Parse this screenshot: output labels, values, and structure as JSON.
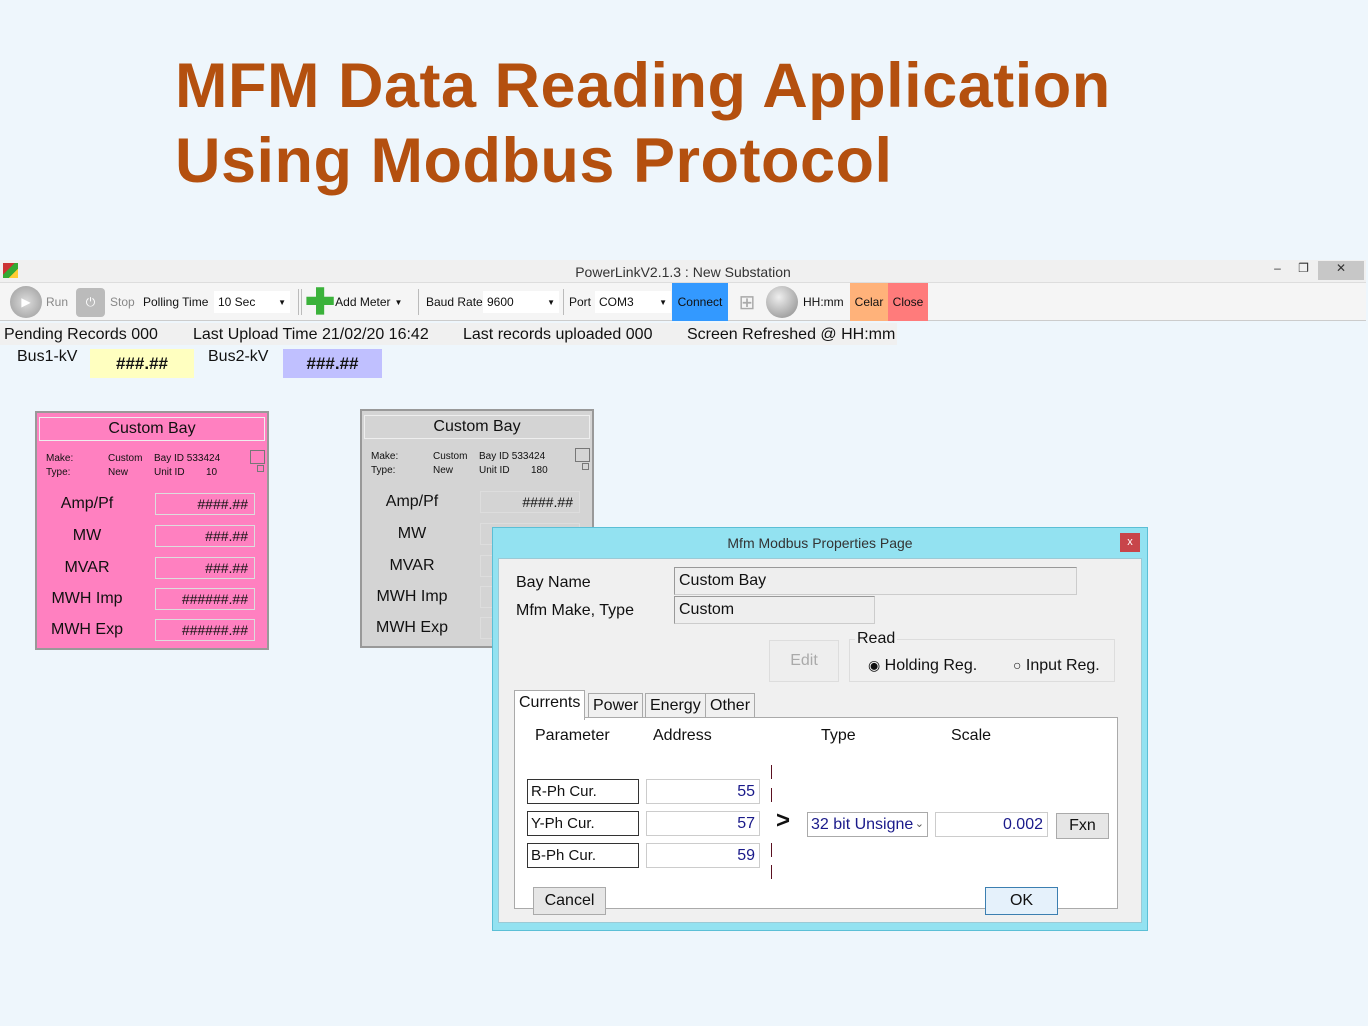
{
  "slide": {
    "title_line1": "MFM Data Reading Application",
    "title_line2": "Using Modbus Protocol"
  },
  "window": {
    "title": "PowerLinkV2.1.3 : New Substation",
    "minimize": "–",
    "restore": "❐",
    "close": "✕"
  },
  "toolbar": {
    "run": "Run",
    "stop": "Stop",
    "polling_label": "Polling Time",
    "polling_value": "10 Sec",
    "add_meter": "Add Meter",
    "baud_label": "Baud Rate",
    "baud_value": "9600",
    "port_label": "Port",
    "port_value": "COM3",
    "connect": "Connect",
    "time": "HH:mm",
    "clear": "Celar",
    "close": "Close",
    "colors": {
      "connect": "#3399ff",
      "clear": "#ffb27a",
      "close": "#ff7b7b"
    }
  },
  "status": {
    "pending": "Pending Records  000",
    "last_upload": "Last Upload Time  21/02/20 16:42",
    "last_records": "Last records uploaded  000",
    "refreshed": "Screen Refreshed @  HH:mm"
  },
  "bus": {
    "bus1_label": "Bus1-kV",
    "bus1_value": "###.##",
    "bus2_label": "Bus2-kV",
    "bus2_value": "###.##"
  },
  "bays": [
    {
      "title": "Custom Bay",
      "make_label": "Make:",
      "make": "Custom",
      "type_label": "Type:",
      "type": "New",
      "bay_id": "Bay ID 533424",
      "unit_label": "Unit ID",
      "unit_id": "10",
      "color": "#ff80c0",
      "rows": [
        {
          "label": "Amp/Pf",
          "value": "####.##"
        },
        {
          "label": "MW",
          "value": "###.##"
        },
        {
          "label": "MVAR",
          "value": "###.##"
        },
        {
          "label": "MWH Imp",
          "value": "######.##"
        },
        {
          "label": "MWH Exp",
          "value": "######.##"
        }
      ]
    },
    {
      "title": "Custom Bay",
      "make_label": "Make:",
      "make": "Custom",
      "type_label": "Type:",
      "type": "New",
      "bay_id": "Bay ID 533424",
      "unit_label": "Unit ID",
      "unit_id": "180",
      "color": "#d4d4d4",
      "rows": [
        {
          "label": "Amp/Pf",
          "value": "####.##"
        },
        {
          "label": "MW",
          "value": ""
        },
        {
          "label": "MVAR",
          "value": ""
        },
        {
          "label": "MWH Imp",
          "value": ""
        },
        {
          "label": "MWH Exp",
          "value": ""
        }
      ]
    }
  ],
  "dialog": {
    "title": "Mfm Modbus Properties Page",
    "close": "x",
    "bay_name_label": "Bay Name",
    "bay_name": "Custom Bay",
    "make_label": "Mfm Make, Type",
    "make": "Custom",
    "edit": "Edit",
    "read_label": "Read",
    "holding": "Holding Reg.",
    "input": "Input Reg.",
    "selected_read": "Holding Reg.",
    "tabs": [
      "Currents",
      "Power",
      "Energy",
      "Other"
    ],
    "active_tab": "Currents",
    "headers": [
      "Parameter",
      "Address",
      "Type",
      "Scale"
    ],
    "params": [
      {
        "name": "R-Ph Cur.",
        "address": "55"
      },
      {
        "name": "Y-Ph Cur.",
        "address": "57"
      },
      {
        "name": "B-Ph Cur.",
        "address": "59"
      }
    ],
    "arrow": ">",
    "type_value": "32 bit Unsigne",
    "scale_value": "0.002",
    "fxn": "Fxn",
    "cancel": "Cancel",
    "ok": "OK"
  }
}
